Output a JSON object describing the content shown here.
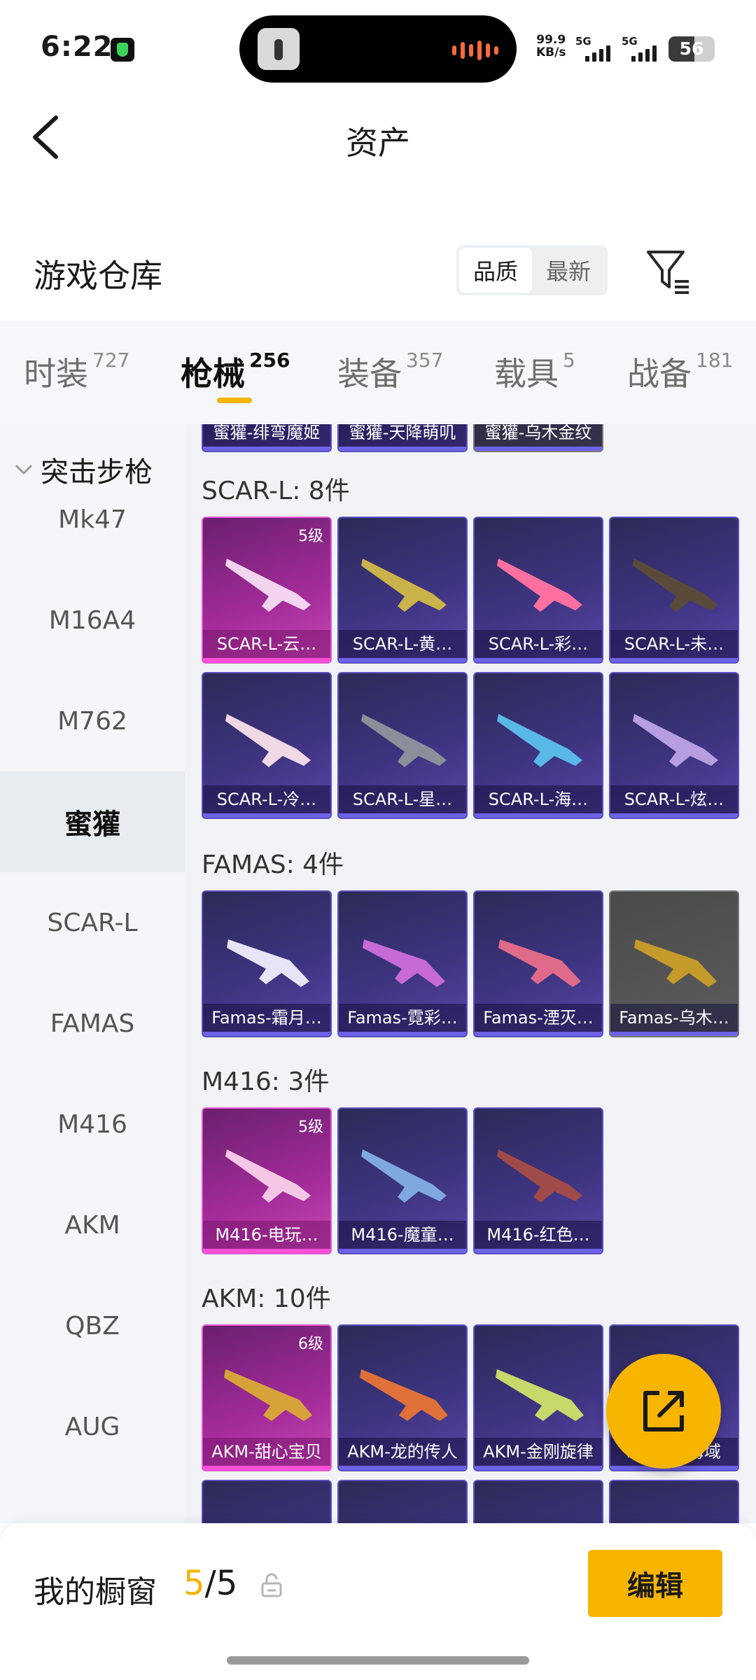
{
  "status_bar": {
    "time": "6:22",
    "net_speed_value": "99.9",
    "net_speed_unit": "KB/s",
    "signal_1": "5G",
    "signal_2": "5G",
    "battery": "56",
    "battery_level": 0.56
  },
  "header": {
    "title": "资产"
  },
  "warehouse": {
    "title": "游戏仓库",
    "sort_options": [
      "品质",
      "最新"
    ],
    "sort_selected": "品质",
    "filter_icon": "filter-icon"
  },
  "tabs": [
    {
      "label": "时装",
      "count": "727"
    },
    {
      "label": "枪械",
      "count": "256",
      "active": true
    },
    {
      "label": "装备",
      "count": "357"
    },
    {
      "label": "载具",
      "count": "5"
    },
    {
      "label": "战备",
      "count": "181"
    }
  ],
  "sidebar": {
    "group": "突击步枪",
    "items": [
      "Mk47",
      "M16A4",
      "M762",
      "蜜獾",
      "SCAR-L",
      "FAMAS",
      "M416",
      "AKM",
      "QBZ",
      "AUG"
    ],
    "active": "蜜獾"
  },
  "grid": {
    "top_partial": [
      "蜜獾-绯弯魔姬",
      "蜜獾-天降萌叽",
      "蜜獾-乌木金纹"
    ],
    "groups": [
      {
        "header": "SCAR-L: 8件",
        "items": [
          {
            "name": "SCAR-L-云…",
            "level": "5级",
            "rarity": "pink"
          },
          {
            "name": "SCAR-L-黄…",
            "rarity": "purple"
          },
          {
            "name": "SCAR-L-彩…",
            "rarity": "purple"
          },
          {
            "name": "SCAR-L-未…",
            "rarity": "purple"
          },
          {
            "name": "SCAR-L-冷…",
            "rarity": "purple"
          },
          {
            "name": "SCAR-L-星…",
            "rarity": "purple"
          },
          {
            "name": "SCAR-L-海…",
            "rarity": "purple"
          },
          {
            "name": "SCAR-L-炫…",
            "rarity": "purple"
          }
        ]
      },
      {
        "header": "FAMAS: 4件",
        "items": [
          {
            "name": "Famas-霜月…",
            "rarity": "purple"
          },
          {
            "name": "Famas-霓彩…",
            "rarity": "purple"
          },
          {
            "name": "Famas-湮灭…",
            "rarity": "purple"
          },
          {
            "name": "Famas-乌木…",
            "rarity": "gray"
          }
        ]
      },
      {
        "header": "M416: 3件",
        "items": [
          {
            "name": "M416-电玩…",
            "level": "5级",
            "rarity": "pink"
          },
          {
            "name": "M416-魔童…",
            "rarity": "purple"
          },
          {
            "name": "M416-红色…",
            "rarity": "purple"
          }
        ]
      },
      {
        "header": "AKM: 10件",
        "items": [
          {
            "name": "AKM-甜心宝贝",
            "level": "6级",
            "rarity": "pink"
          },
          {
            "name": "AKM-龙的传人",
            "rarity": "purple"
          },
          {
            "name": "AKM-金刚旋律",
            "rarity": "purple"
          },
          {
            "name": "AKM-…海域",
            "rarity": "purple"
          }
        ]
      }
    ]
  },
  "showcase": {
    "label": "我的橱窗",
    "current": "5",
    "separator": "/",
    "total": "5",
    "edit_label": "编辑"
  },
  "colors": {
    "accent": "#f5b400",
    "pink_rarity": "#ff4fd8",
    "purple_rarity": "#6e63e8"
  }
}
